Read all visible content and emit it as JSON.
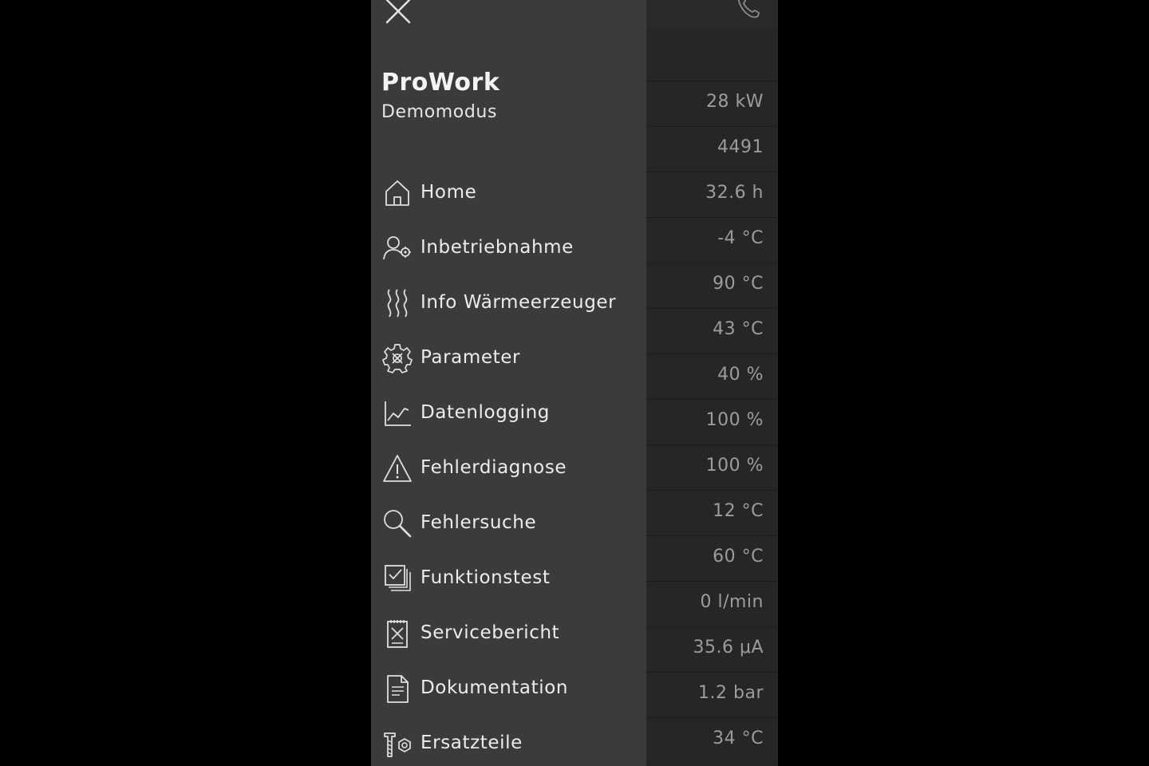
{
  "drawer": {
    "title": "ProWork",
    "subtitle": "Demomodus",
    "close_icon": "close-icon",
    "items": [
      {
        "label": "Home",
        "icon": "home-icon"
      },
      {
        "label": "Inbetriebnahme",
        "icon": "user-gear-icon"
      },
      {
        "label": "Info Wärmeerzeuger",
        "icon": "heat-waves-icon"
      },
      {
        "label": "Parameter",
        "icon": "settings-gear-icon"
      },
      {
        "label": "Datenlogging",
        "icon": "line-chart-icon"
      },
      {
        "label": "Fehlerdiagnose",
        "icon": "warning-icon"
      },
      {
        "label": "Fehlersuche",
        "icon": "search-icon"
      },
      {
        "label": "Funktionstest",
        "icon": "checklist-icon"
      },
      {
        "label": "Servicebericht",
        "icon": "service-report-icon"
      },
      {
        "label": "Dokumentation",
        "icon": "document-icon"
      },
      {
        "label": "Ersatzteile",
        "icon": "spare-parts-icon"
      }
    ]
  },
  "background": {
    "phone_icon": "phone-icon",
    "values": [
      "28 kW",
      "4491",
      "32.6 h",
      "-4 °C",
      "90 °C",
      "43 °C",
      "40 %",
      "100 %",
      "100 %",
      "12 °C",
      "60 °C",
      "0 l/min",
      "35.6 μA",
      "1.2 bar",
      "34 °C"
    ]
  },
  "colors": {
    "page_background": "#000000",
    "drawer_background": "#3b3b3b",
    "background_screen": "#262626",
    "text_primary": "#ececec",
    "text_secondary": "#9c9c9c"
  }
}
